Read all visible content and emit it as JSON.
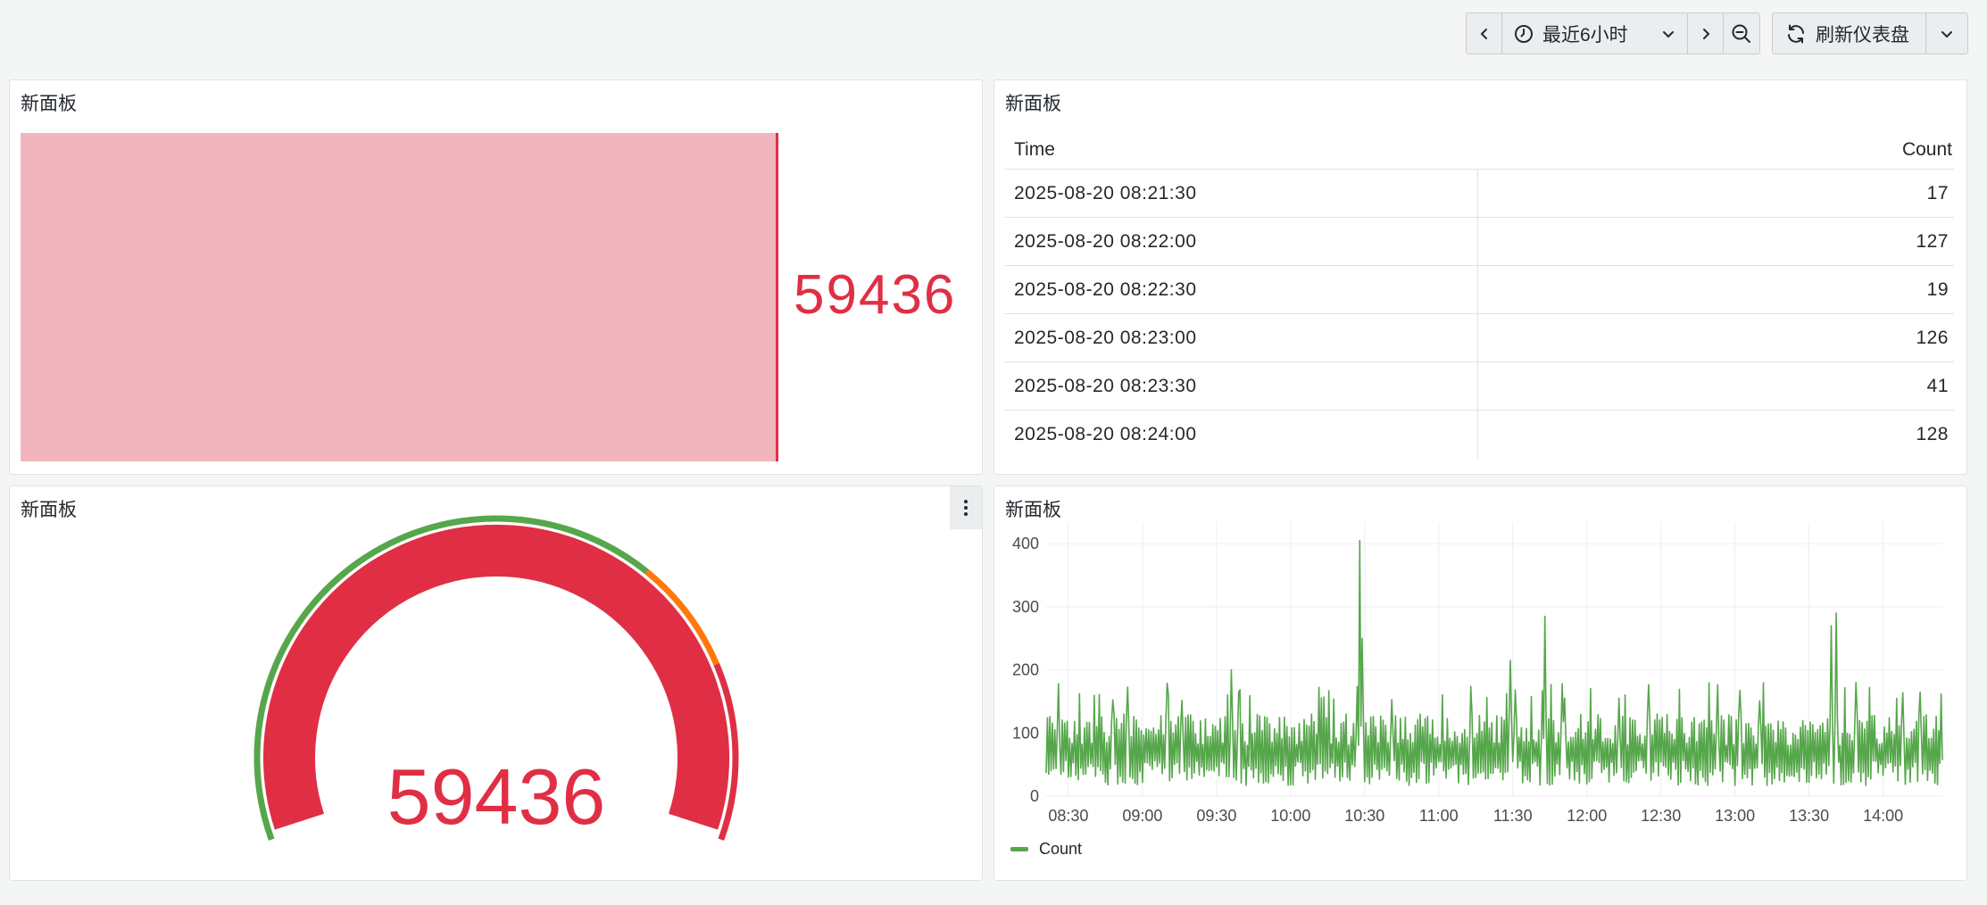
{
  "toolbar": {
    "time_range_label": "最近6小时",
    "refresh_label": "刷新仪表盘"
  },
  "panels": {
    "bar": {
      "title": "新面板",
      "value": "59436"
    },
    "table": {
      "title": "新面板",
      "columns": [
        "Time",
        "Count"
      ],
      "rows": [
        [
          "2025-08-20 08:21:30",
          "17"
        ],
        [
          "2025-08-20 08:22:00",
          "127"
        ],
        [
          "2025-08-20 08:22:30",
          "19"
        ],
        [
          "2025-08-20 08:23:00",
          "126"
        ],
        [
          "2025-08-20 08:23:30",
          "41"
        ],
        [
          "2025-08-20 08:24:00",
          "128"
        ]
      ]
    },
    "gauge": {
      "title": "新面板",
      "value": "59436"
    },
    "timeseries": {
      "title": "新面板",
      "legend": "Count"
    }
  },
  "colors": {
    "red": "#e02f44",
    "light_red": "#f2b5bd",
    "green": "#56a64b",
    "orange": "#ff780a"
  },
  "icons": [
    "chevron-left-icon",
    "clock-icon",
    "chevron-down-icon",
    "chevron-right-icon",
    "zoom-out-icon",
    "refresh-icon",
    "more-vertical-icon"
  ],
  "chart_data": {
    "type": "line",
    "x": [
      "08:30",
      "09:00",
      "09:30",
      "10:00",
      "10:30",
      "11:00",
      "11:30",
      "12:00",
      "12:30",
      "13:00",
      "13:30",
      "14:00"
    ],
    "y_ticks": [
      0,
      100,
      200,
      300,
      400
    ],
    "ylim": [
      0,
      420
    ],
    "series": [
      {
        "name": "Count",
        "baseline_low": 17,
        "baseline_high": 130,
        "spikes": [
          {
            "x": "09:36",
            "y": 200
          },
          {
            "x": "10:28",
            "y": 405
          },
          {
            "x": "10:29",
            "y": 250
          },
          {
            "x": "11:29",
            "y": 215
          },
          {
            "x": "11:43",
            "y": 285
          },
          {
            "x": "13:39",
            "y": 270
          },
          {
            "x": "13:41",
            "y": 290
          }
        ]
      }
    ]
  }
}
